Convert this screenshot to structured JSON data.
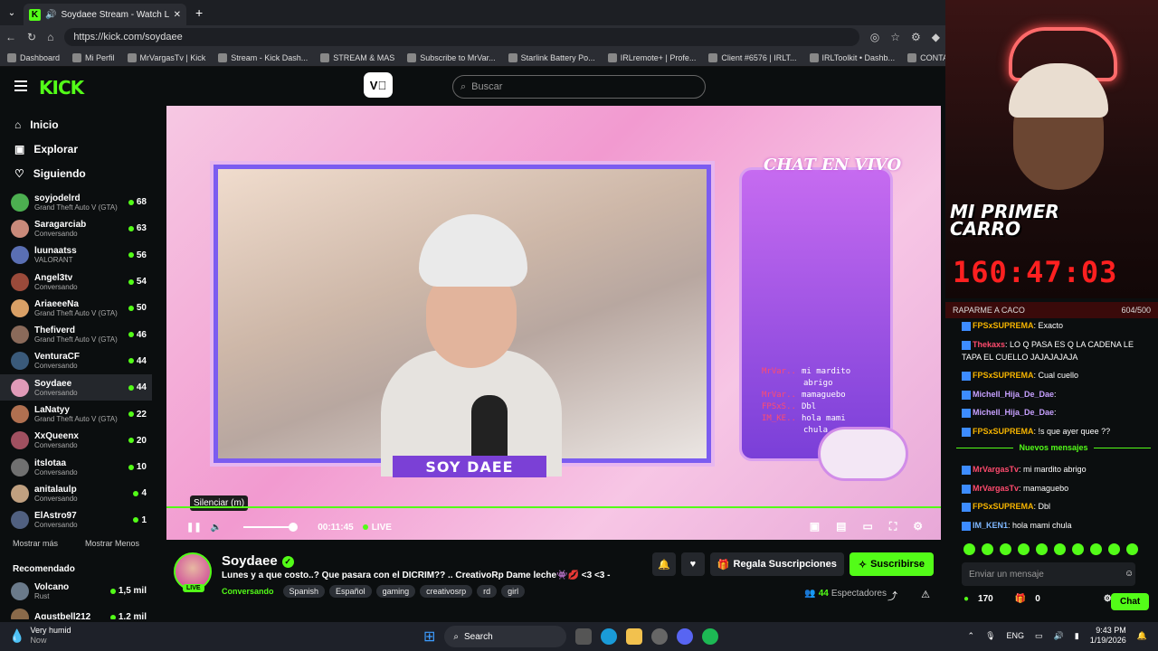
{
  "browser": {
    "tab_title": "Soydaee Stream - Watch Live",
    "url": "https://kick.com/soydaee",
    "bookmarks": [
      "Dashboard",
      "Mi Perfil",
      "MrVargasTv | Kick",
      "Stream - Kick Dash...",
      "STREAM & MAS",
      "Subscribe to MrVar...",
      "Starlink Battery Po...",
      "IRLremote+ | Profe...",
      "Client #6576 | IRLT...",
      "IRLToolkit • Dashb...",
      "CONTADOR"
    ]
  },
  "header": {
    "logo": "KICK",
    "search_placeholder": "Buscar"
  },
  "sidebar": {
    "nav": [
      {
        "label": "Inicio"
      },
      {
        "label": "Explorar"
      },
      {
        "label": "Siguiendo"
      }
    ],
    "channels": [
      {
        "name": "soyjodelrd",
        "game": "Grand Theft Auto V (GTA)",
        "viewers": "68",
        "color": "#4caf50"
      },
      {
        "name": "Saragarciab",
        "game": "Conversando",
        "viewers": "63",
        "color": "#c98a7a"
      },
      {
        "name": "luunaatss",
        "game": "VALORANT",
        "viewers": "56",
        "color": "#5a6fb3"
      },
      {
        "name": "Angel3tv",
        "game": "Conversando",
        "viewers": "54",
        "color": "#9a4a3a"
      },
      {
        "name": "AriaeeeNa",
        "game": "Grand Theft Auto V (GTA)",
        "viewers": "50",
        "color": "#d9a066"
      },
      {
        "name": "Thefiverd",
        "game": "Grand Theft Auto V (GTA)",
        "viewers": "46",
        "color": "#8a6a5a"
      },
      {
        "name": "VenturaCF",
        "game": "Conversando",
        "viewers": "44",
        "color": "#3a5a7a"
      },
      {
        "name": "Soydaee",
        "game": "Conversando",
        "viewers": "44",
        "color": "#e09ab8"
      },
      {
        "name": "LaNatyy",
        "game": "Grand Theft Auto V (GTA)",
        "viewers": "22",
        "color": "#b07050"
      },
      {
        "name": "XxQueenx",
        "game": "Conversando",
        "viewers": "20",
        "color": "#a05060"
      },
      {
        "name": "itslotaa",
        "game": "Conversando",
        "viewers": "10",
        "color": "#707070"
      },
      {
        "name": "anitalaulp",
        "game": "Conversando",
        "viewers": "4",
        "color": "#c0a080"
      },
      {
        "name": "ElAstro97",
        "game": "Conversando",
        "viewers": "1",
        "color": "#506080"
      }
    ],
    "show_more": "Mostrar más",
    "show_less": "Mostrar Menos",
    "recommended_title": "Recomendado",
    "recommended": [
      {
        "name": "Volcano",
        "game": "Rust",
        "viewers": "1,5 mil",
        "color": "#6a7a8a"
      },
      {
        "name": "Agustbell212",
        "game": "",
        "viewers": "1,2 mil",
        "color": "#8a6a4a"
      }
    ]
  },
  "video": {
    "overlay_chat_title": "CHAT EN VIVO",
    "overlay_lines": [
      {
        "user": "MrVar..",
        "text": "mi mardito"
      },
      {
        "user": "",
        "text": "abrigo"
      },
      {
        "user": "MrVar..",
        "text": "mamaguebo"
      },
      {
        "user": "FPSxS..",
        "text": "Dbl"
      },
      {
        "user": "IM_KE..",
        "text": "hola mami"
      },
      {
        "user": "",
        "text": "chula"
      }
    ],
    "banner_name": "SOY DAEE",
    "tooltip": "Silenciar (m)",
    "time": "00:11:45",
    "live": "LIVE"
  },
  "stream": {
    "name": "Soydaee",
    "live_badge": "LIVE",
    "title": "Lunes y a que costo..? Que pasara con el DICRIM?? .. CreativoRp Dame leche👾💋 <3 <3 -",
    "category": "Conversando",
    "tags": [
      "Spanish",
      "Español",
      "gaming",
      "creativosrp",
      "rd",
      "girl"
    ],
    "gift_label": "Regala Suscripciones",
    "subscribe_label": "Suscribirse",
    "viewers": "44",
    "viewers_label": "Espectadores"
  },
  "cam2": {
    "line1": "MI PRIMER",
    "line2": "CARRO",
    "timer": "160:47:03"
  },
  "goal": {
    "label": "RAPARME A CACO",
    "progress": "604/500"
  },
  "chat": {
    "messages": [
      {
        "user": "FPSxSUPREMA",
        "text": "Exacto",
        "color": "#f6b400"
      },
      {
        "user": "Thekaxs",
        "text": "LO Q PASA ES Q LA CADENA LE TAPA EL CUELLO JAJAJAJAJA",
        "color": "#ff4b6e"
      },
      {
        "user": "FPSxSUPREMA",
        "text": "Cual cuello",
        "color": "#f6b400"
      },
      {
        "user": "Michell_Hija_De_Dae",
        "text": "",
        "color": "#c7a0ff"
      },
      {
        "user": "Michell_Hija_De_Dae",
        "text": "",
        "color": "#c7a0ff"
      },
      {
        "user": "FPSxSUPREMA",
        "text": "!s que ayer quee ??",
        "color": "#f6b400"
      }
    ],
    "new_messages": "Nuevos mensajes",
    "messages2": [
      {
        "user": "MrVargasTv",
        "text": "mi mardito abrigo",
        "color": "#ff4b6e"
      },
      {
        "user": "MrVargasTv",
        "text": "mamaguebo",
        "color": "#ff4b6e"
      },
      {
        "user": "FPSxSUPREMA",
        "text": "Dbl",
        "color": "#f6b400"
      },
      {
        "user": "IM_KEN1",
        "text": "hola mami chula",
        "color": "#7fb8ff"
      }
    ],
    "input_placeholder": "Enviar un mensaje",
    "points": "170",
    "gifts": "0",
    "chat_button": "Chat"
  },
  "taskbar": {
    "weather": "Very humid",
    "weather_sub": "Now",
    "search": "Search",
    "lang": "ENG",
    "time": "9:43 PM",
    "date": "1/19/2026"
  }
}
